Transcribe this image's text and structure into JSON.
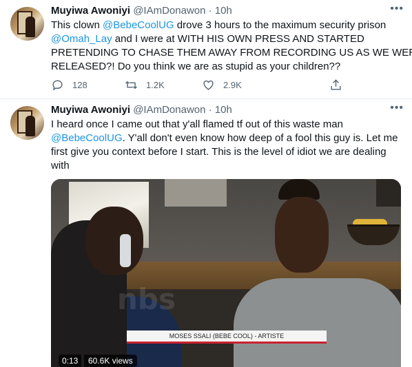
{
  "tweets": [
    {
      "author_name": "Muyiwa Awoniyi",
      "handle": "@IAmDonawon",
      "separator": "·",
      "time": "10h",
      "more_icon": "more-dots-icon",
      "text_lines": [
        [
          "This clown ",
          "@BebeCoolUG",
          " drove 3 hours to the maximum security prison"
        ],
        [
          "@Omah_Lay",
          " and I were at WITH HIS OWN PRESS AND STARTED"
        ],
        [
          "PRETENDING TO CHASE THEM AWAY FROM RECORDING US AS WE WERE"
        ],
        [
          "RELEASED?! Do you think we are as stupid as your children??"
        ]
      ],
      "replies": "128",
      "retweets": "1.2K",
      "likes": "2.9K"
    },
    {
      "author_name": "Muyiwa Awoniyi",
      "handle": "@IAmDonawon",
      "separator": "·",
      "time": "10h",
      "more_icon": "more-dots-icon",
      "text_lines": [
        [
          "I heard once I came out that y'all flamed tf out of this waste man"
        ],
        [
          "@BebeCoolUG",
          ". Y'all don't even know how deep of a fool this guy is. Let me"
        ],
        [
          "first give you context before I start. This is the level of idiot we are dealing"
        ],
        [
          "with"
        ]
      ],
      "video": {
        "caption": "MOSES SSALI (BEBE COOL) - ARTISTE",
        "watermark": "nbs",
        "duration": "0:13",
        "views": "60.6K views"
      }
    }
  ],
  "colors": {
    "mention": "#1b95e0",
    "muted": "#536471",
    "text": "#0f1419",
    "divider": "#e6ecf0"
  },
  "icons": [
    "reply-icon",
    "retweet-icon",
    "like-icon",
    "share-icon",
    "more-dots-icon"
  ]
}
